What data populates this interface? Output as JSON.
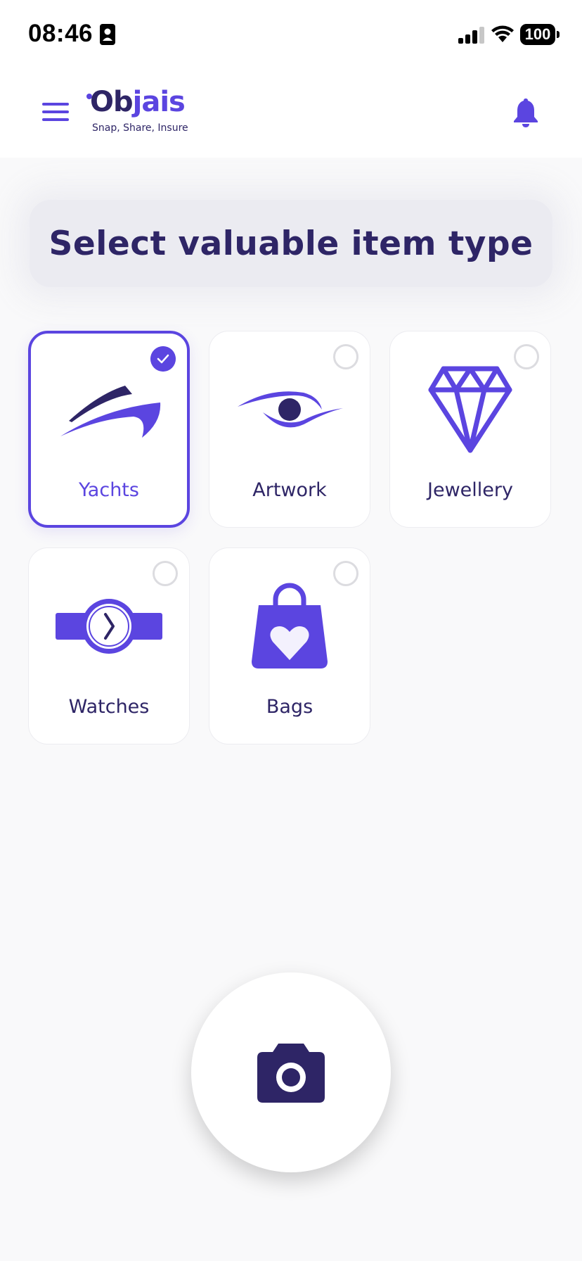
{
  "status_bar": {
    "time": "08:46",
    "battery": "100",
    "icons": [
      "contact-card-icon",
      "cellular-signal-icon",
      "wifi-icon",
      "battery-icon"
    ]
  },
  "header": {
    "menu_icon": "hamburger-menu-icon",
    "logo": {
      "text_dark": "Ob",
      "text_light": "jais",
      "tagline": "Snap, Share, Insure"
    },
    "notification_icon": "bell-icon"
  },
  "main": {
    "title": "Select valuable item type",
    "items": [
      {
        "label": "Yachts",
        "icon": "yacht-icon",
        "selected": true
      },
      {
        "label": "Artwork",
        "icon": "eye-icon",
        "selected": false
      },
      {
        "label": "Jewellery",
        "icon": "diamond-icon",
        "selected": false
      },
      {
        "label": "Watches",
        "icon": "watch-icon",
        "selected": false
      },
      {
        "label": "Bags",
        "icon": "shopping-bag-heart-icon",
        "selected": false
      }
    ]
  },
  "camera_button": {
    "icon": "camera-icon"
  },
  "colors": {
    "accent": "#5b45e0",
    "dark": "#2e2566",
    "background": "#f9f9fa",
    "banner": "#ebebf1"
  }
}
